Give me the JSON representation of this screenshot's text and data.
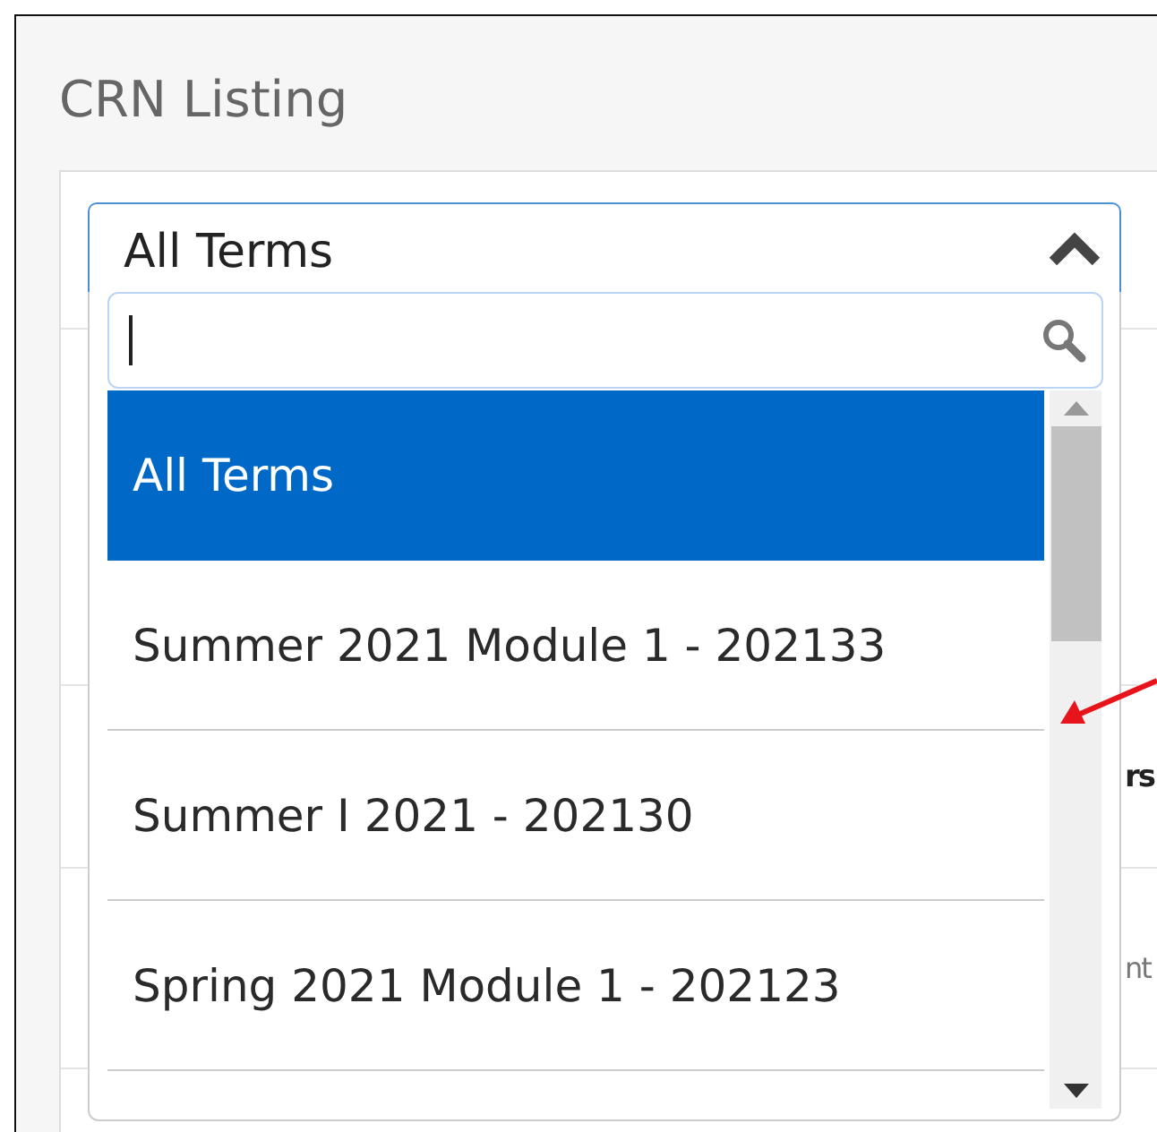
{
  "page": {
    "title": "CRN Listing"
  },
  "term_select": {
    "value": "All Terms",
    "expanded": true,
    "options": [
      {
        "label": "All Terms",
        "selected": true
      },
      {
        "label": "Summer 2021 Module 1 - 202133",
        "selected": false
      },
      {
        "label": "Summer I 2021 - 202130",
        "selected": false
      },
      {
        "label": "Spring 2021 Module 1 - 202123",
        "selected": false
      }
    ]
  },
  "background_rows": [
    {
      "text": "rs",
      "kind": "bold"
    },
    {
      "text": "nt",
      "kind": "muted"
    }
  ]
}
